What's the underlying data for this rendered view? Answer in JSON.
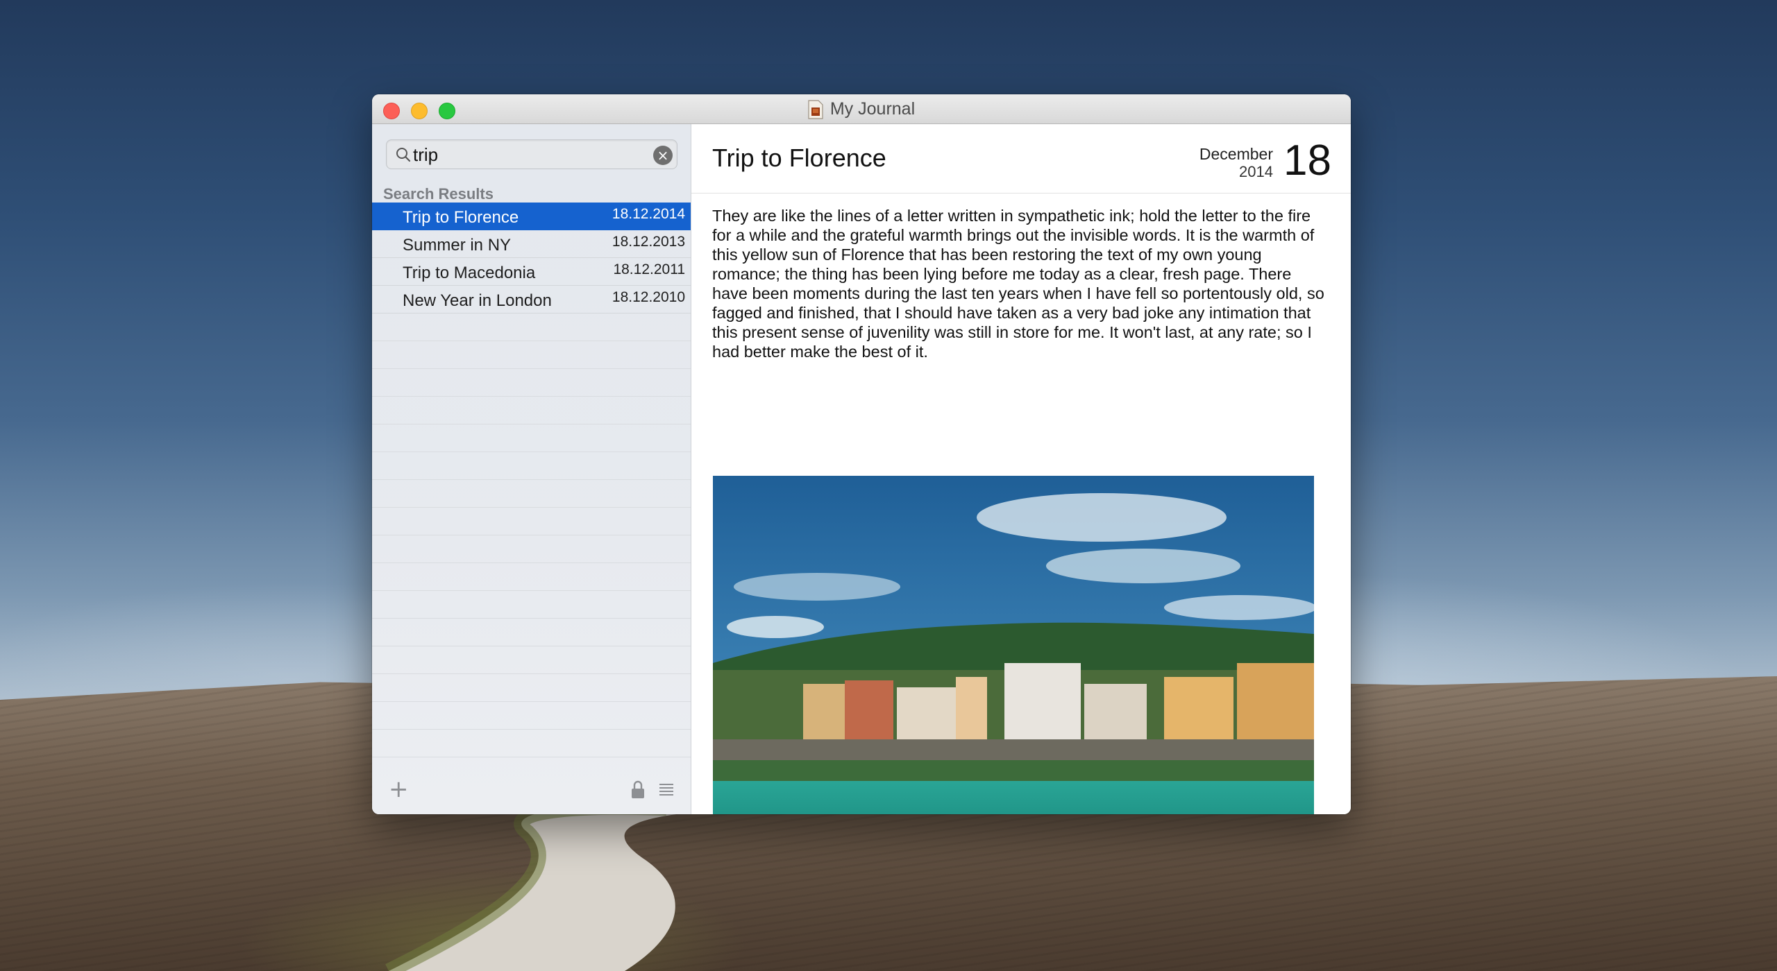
{
  "window": {
    "title": "My Journal"
  },
  "search": {
    "value": "trip",
    "clear_symbol": "×"
  },
  "sidebar": {
    "section_header": "Search Results",
    "results": [
      {
        "title": "Trip to Florence",
        "date": "18.12.2014",
        "selected": true
      },
      {
        "title": "Summer in NY",
        "date": "18.12.2013",
        "selected": false
      },
      {
        "title": "Trip to Macedonia",
        "date": "18.12.2011",
        "selected": false
      },
      {
        "title": "New Year in London",
        "date": "18.12.2010",
        "selected": false
      }
    ],
    "footer": {
      "add_symbol": "+",
      "icons": [
        "plus-icon",
        "lock-icon",
        "list-icon"
      ]
    }
  },
  "entry": {
    "title": "Trip to Florence",
    "month": "December",
    "year": "2014",
    "day": "18",
    "body": "They are like the lines of a letter written in sympathetic ink; hold the letter to the fire for a while and the grateful warmth brings out the invisible words.  It is the warmth of this yellow sun of Florence that has been restoring the text of my own young romance; the thing has been lying before me today as a clear, fresh page. There have been moments during the last ten years when I have fell so portentously old, so fagged and finished, that I should have taken as a very bad joke any intimation that this present sense of juvenility was still in store for me.  It won't last, at any rate; so I had better make the best of it."
  },
  "colors": {
    "selection": "#1562cf",
    "close": "#fc5f57",
    "minimize": "#fdbc2e",
    "maximize": "#28c840"
  }
}
